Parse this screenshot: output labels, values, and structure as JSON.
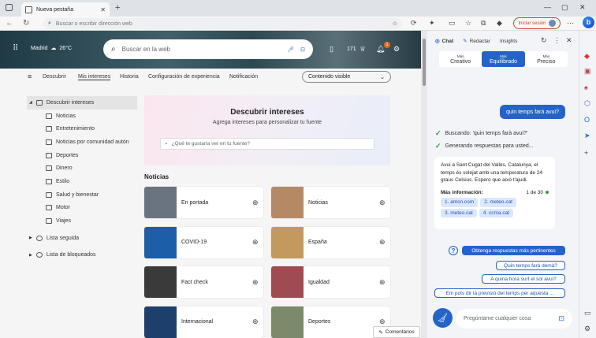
{
  "browser": {
    "tab_title": "Nueva pestaña",
    "address_placeholder": "Buscar o escribir dirección web",
    "signin_label": "Iniciar sesión"
  },
  "header": {
    "location": "Madrid",
    "temperature": "26°C",
    "search_placeholder": "Buscar en la web",
    "points": "171",
    "notif_count": "1"
  },
  "subnav": {
    "items": [
      "Descubrir",
      "Mis intereses",
      "Historia",
      "Configuración de experiencia",
      "Notificación"
    ],
    "dropdown": "Contenido visible"
  },
  "sidebar": {
    "items": [
      {
        "label": "Descubrir intereses",
        "level": "top",
        "active": true
      },
      {
        "label": "Noticias",
        "level": "sub"
      },
      {
        "label": "Entretenimiento",
        "level": "sub"
      },
      {
        "label": "Noticias por comunidad autón",
        "level": "sub"
      },
      {
        "label": "Deportes",
        "level": "sub"
      },
      {
        "label": "Dinero",
        "level": "sub"
      },
      {
        "label": "Estilo",
        "level": "sub"
      },
      {
        "label": "Salud y bienestar",
        "level": "sub"
      },
      {
        "label": "Motor",
        "level": "sub"
      },
      {
        "label": "Viajes",
        "level": "sub"
      },
      {
        "label": "Lista seguida",
        "level": "group"
      },
      {
        "label": "Lista de bloqueados",
        "level": "group"
      }
    ]
  },
  "discover": {
    "title": "Descubrir intereses",
    "subtitle": "Agrega intereses para personalizar tu fuente",
    "input_placeholder": "¿Qué te gustaría ver en tu fuente?"
  },
  "news": {
    "section_title": "Noticias",
    "cards": [
      {
        "label": "En portada",
        "color": "#6a7480"
      },
      {
        "label": "Noticias",
        "color": "#b48a66"
      },
      {
        "label": "COVID-19",
        "color": "#1c5fa8"
      },
      {
        "label": "España",
        "color": "#c39a5e"
      },
      {
        "label": "Fact check",
        "color": "#3a3a3a"
      },
      {
        "label": "Igualdad",
        "color": "#a04a52"
      },
      {
        "label": "Internacional",
        "color": "#1d3f6b"
      },
      {
        "label": "Deportes",
        "color": "#7a8a6a"
      }
    ]
  },
  "feedback_label": "Comentarios",
  "copilot": {
    "tabs": [
      "Chat",
      "Redactar",
      "Insights"
    ],
    "styles": [
      {
        "small": "Más",
        "label": "Creativo"
      },
      {
        "small": "Más",
        "label": "Equilibrado",
        "active": true
      },
      {
        "small": "Más",
        "label": "Preciso"
      }
    ],
    "user_message": "quin temps farà avui?",
    "steps": [
      "Buscando: 'quin temps farà avui?'",
      "Generando respuestas para usted..."
    ],
    "answer": "Avui a Sant Cugat del Vallès, Catalunya, el temps és solejat amb una temperatura de 24 graus Celsius. Espero que això t'ajudi.",
    "more_info_label": "Más información:",
    "more_info_count": "1 de 30",
    "sources": [
      "1. amsn.com",
      "2. meteo.cat",
      "3. meteo.cat",
      "4. ccma.cat"
    ],
    "suggestions": [
      "Obtenga respuestas más pertinentes",
      "Quin temps farà demà?",
      "A quina hora surt el sol avui?",
      "Em pots dir la previsió del temps per aquesta ..."
    ],
    "ask_placeholder": "Pregúntame cualquier cosa"
  }
}
